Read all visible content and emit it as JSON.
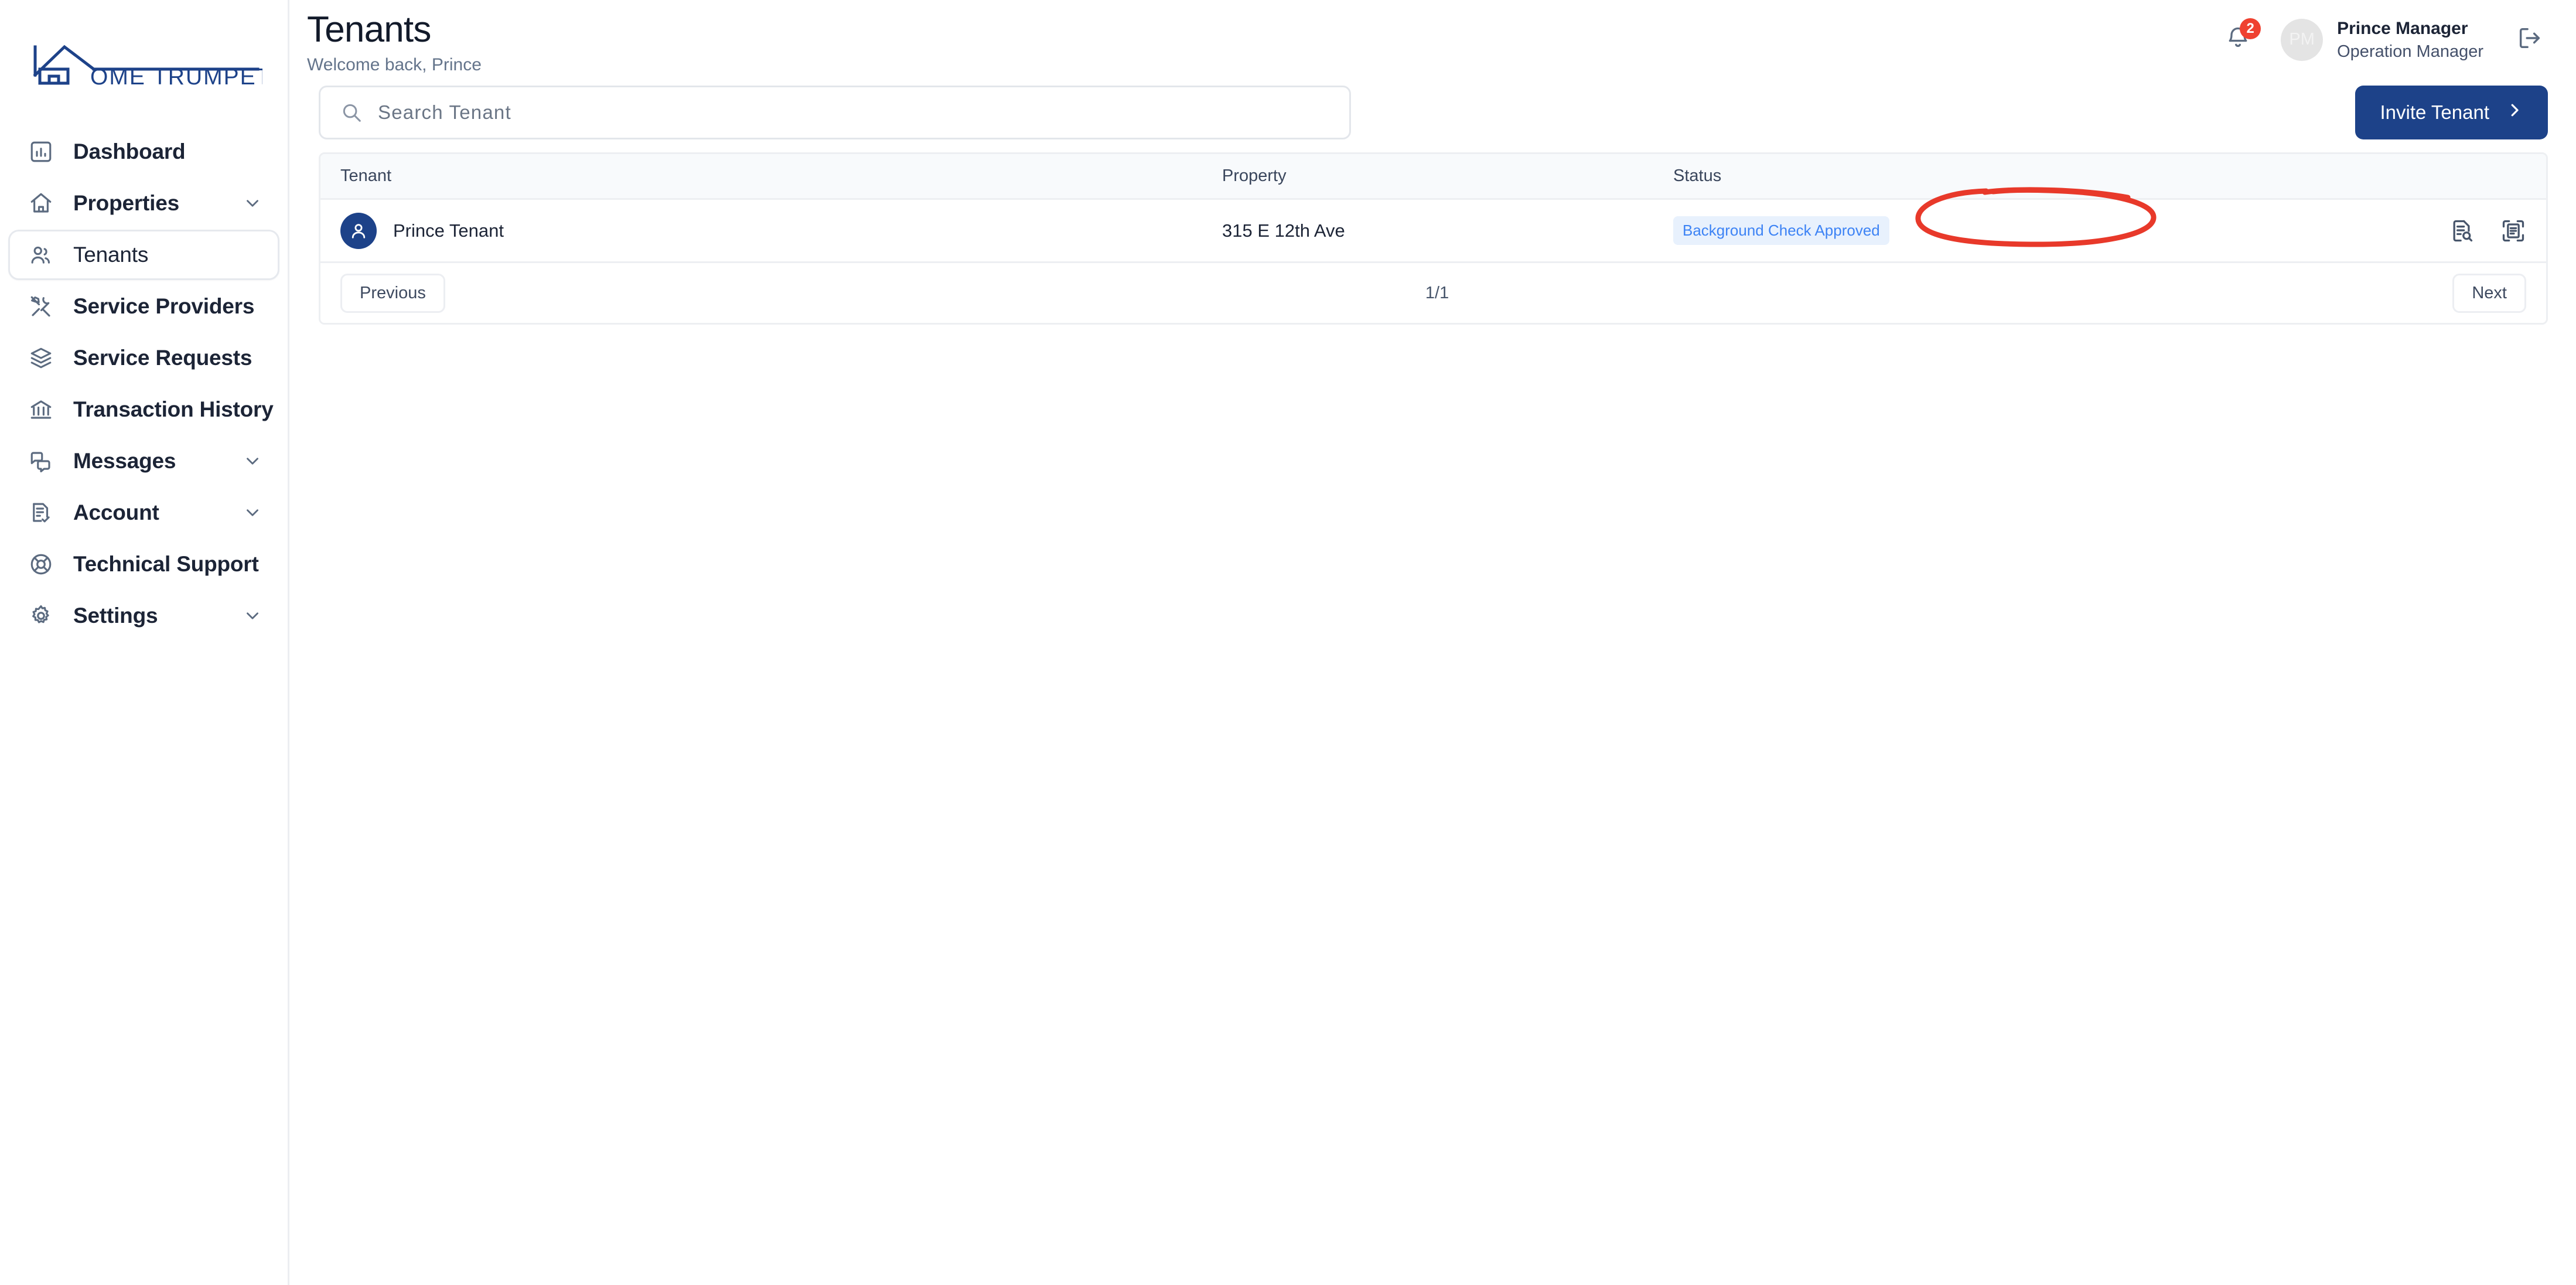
{
  "brand": {
    "name": "OME TRUMPETER",
    "full_name": "HOME TRUMPETER",
    "color": "#1d4289"
  },
  "sidebar": {
    "items": [
      {
        "label": "Dashboard",
        "icon": "chart-bar-icon",
        "active": false,
        "expandable": false
      },
      {
        "label": "Properties",
        "icon": "home-icon",
        "active": false,
        "expandable": true
      },
      {
        "label": "Tenants",
        "icon": "users-icon",
        "active": true,
        "expandable": false
      },
      {
        "label": "Service Providers",
        "icon": "tools-icon",
        "active": false,
        "expandable": false
      },
      {
        "label": "Service Requests",
        "icon": "layers-icon",
        "active": false,
        "expandable": false
      },
      {
        "label": "Transaction History",
        "icon": "bank-icon",
        "active": false,
        "expandable": false
      },
      {
        "label": "Messages",
        "icon": "chat-icon",
        "active": false,
        "expandable": true
      },
      {
        "label": "Account",
        "icon": "document-check-icon",
        "active": false,
        "expandable": true
      },
      {
        "label": "Technical Support",
        "icon": "lifebuoy-icon",
        "active": false,
        "expandable": false
      },
      {
        "label": "Settings",
        "icon": "gear-icon",
        "active": false,
        "expandable": true
      }
    ]
  },
  "header": {
    "title": "Tenants",
    "subtitle": "Welcome back, Prince",
    "notifications": {
      "icon": "bell-icon",
      "count": "2",
      "badge_color": "#ef4130"
    },
    "user": {
      "initials": "PM",
      "name": "Prince Manager",
      "role": "Operation Manager"
    },
    "logout": {
      "icon": "logout-icon",
      "label": "Logout"
    }
  },
  "toolbar": {
    "search": {
      "icon": "search-icon",
      "placeholder": "Search Tenant",
      "value": ""
    },
    "invite_button": {
      "label": "Invite Tenant",
      "icon": "chevron-right-icon",
      "color": "#1d4289"
    }
  },
  "table": {
    "columns": [
      "Tenant",
      "Property",
      "Status"
    ],
    "rows": [
      {
        "avatar_icon": "user-avatar-icon",
        "tenant": "Prince Tenant",
        "property": "315 E 12th Ave",
        "status": "Background Check Approved",
        "status_bg": "#e8f1fd",
        "status_color": "#3d83f5",
        "actions": [
          {
            "icon": "document-search-icon",
            "label": "View details"
          },
          {
            "icon": "document-scan-icon",
            "label": "Scan document"
          }
        ]
      }
    ]
  },
  "pagination": {
    "previous_label": "Previous",
    "page_indicator": "1/1",
    "next_label": "Next"
  },
  "annotation": {
    "shape": "ellipse",
    "color": "#e8392a",
    "target": "Background Check Approved"
  }
}
